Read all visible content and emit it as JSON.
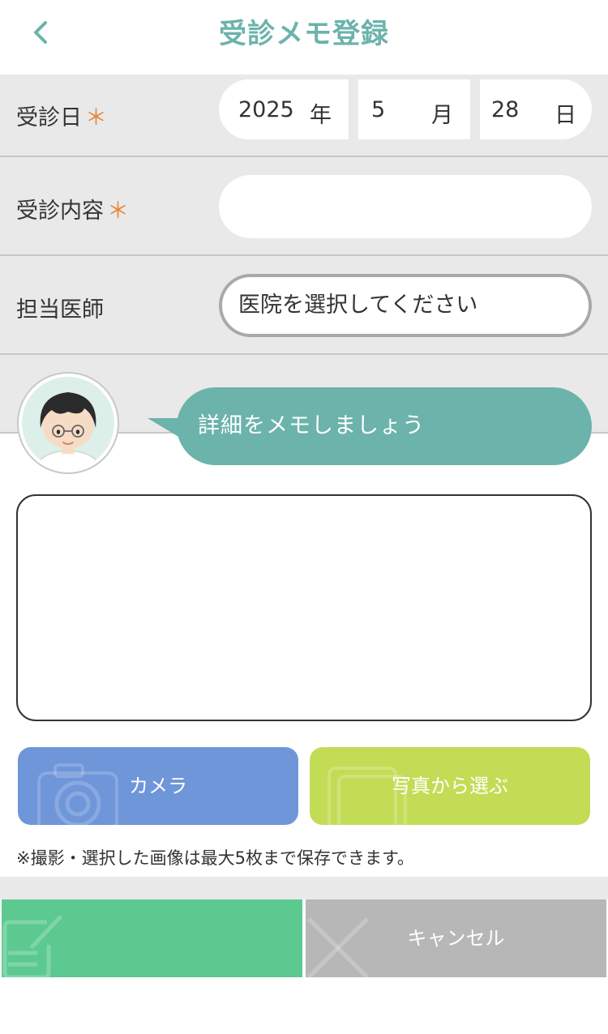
{
  "header": {
    "title": "受診メモ登録",
    "back_icon": "chevron-left-icon"
  },
  "visit_date": {
    "label": "受診日",
    "required_mark": "＊",
    "year": "2025",
    "year_unit": "年",
    "month": "5",
    "month_unit": "月",
    "day": "28",
    "day_unit": "日"
  },
  "visit_content": {
    "label": "受診内容",
    "required_mark": "＊",
    "value": ""
  },
  "doctor": {
    "label": "担当医師",
    "value": "医院を選択してください"
  },
  "speech": {
    "text": "詳細をメモしましょう",
    "avatar_icon": "doctor-avatar-icon"
  },
  "memo": {
    "value": ""
  },
  "buttons": {
    "camera": "カメラ",
    "photo": "写真から選ぶ",
    "cancel": "キャンセル"
  },
  "note": "※撮影・選択した画像は最大5枚まで保存できます。",
  "colors": {
    "accent": "#6bb3ab",
    "required": "#e8873a",
    "camera": "#6f96d9",
    "photo": "#c3dc56",
    "save": "#5cc991",
    "cancel": "#b7b7b7"
  }
}
